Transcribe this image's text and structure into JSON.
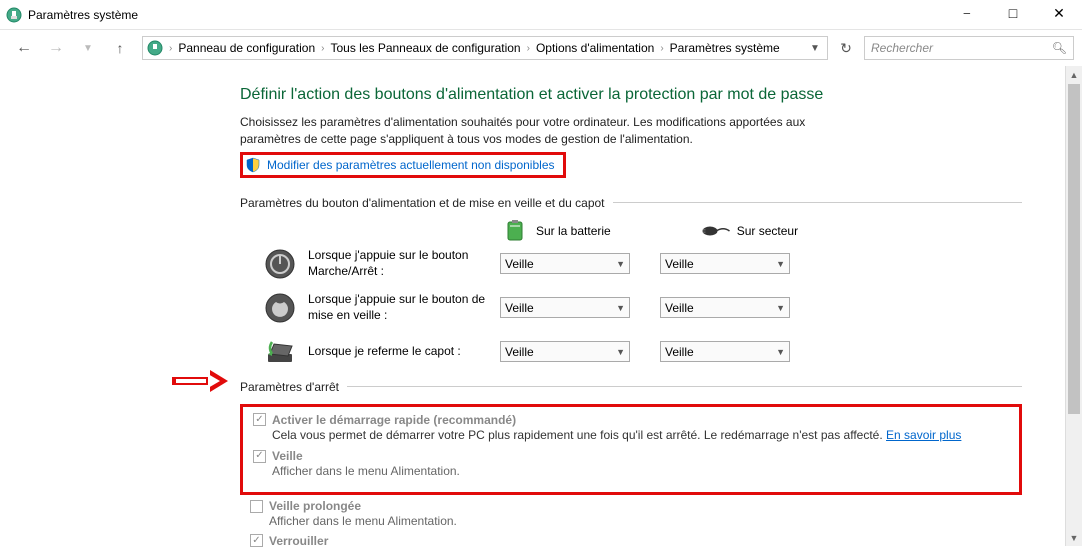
{
  "window": {
    "title": "Paramètres système"
  },
  "breadcrumb": {
    "items": [
      "Panneau de configuration",
      "Tous les Panneaux de configuration",
      "Options d'alimentation",
      "Paramètres système"
    ]
  },
  "search": {
    "placeholder": "Rechercher"
  },
  "page": {
    "title": "Définir l'action des boutons d'alimentation et activer la protection par mot de passe",
    "subtitle": "Choisissez les paramètres d'alimentation souhaités pour votre ordinateur. Les modifications apportées aux paramètres de cette page s'appliquent à tous vos modes de gestion de l'alimentation.",
    "modify_link": "Modifier des paramètres actuellement non disponibles"
  },
  "group": {
    "buttons_header": "Paramètres du bouton d'alimentation et de mise en veille et du capot",
    "shutdown_header": "Paramètres d'arrêt"
  },
  "columns": {
    "battery": "Sur la batterie",
    "plugged": "Sur secteur"
  },
  "rows": {
    "power_btn": {
      "label": "Lorsque j'appuie sur le bouton Marche/Arrêt :",
      "battery": "Veille",
      "plugged": "Veille"
    },
    "sleep_btn": {
      "label": "Lorsque j'appuie sur le bouton de mise en veille :",
      "battery": "Veille",
      "plugged": "Veille"
    },
    "lid": {
      "label": "Lorsque je referme le capot :",
      "battery": "Veille",
      "plugged": "Veille"
    }
  },
  "shutdown": {
    "fast_startup": {
      "label": "Activer le démarrage rapide (recommandé)",
      "desc": "Cela vous permet de démarrer votre PC plus rapidement une fois qu'il est arrêté. Le redémarrage n'est pas affecté.",
      "more": "En savoir plus"
    },
    "sleep": {
      "label": "Veille",
      "desc": "Afficher dans le menu Alimentation."
    },
    "hibernate": {
      "label": "Veille prolongée",
      "desc": "Afficher dans le menu Alimentation."
    },
    "lock": {
      "label": "Verrouiller"
    }
  }
}
